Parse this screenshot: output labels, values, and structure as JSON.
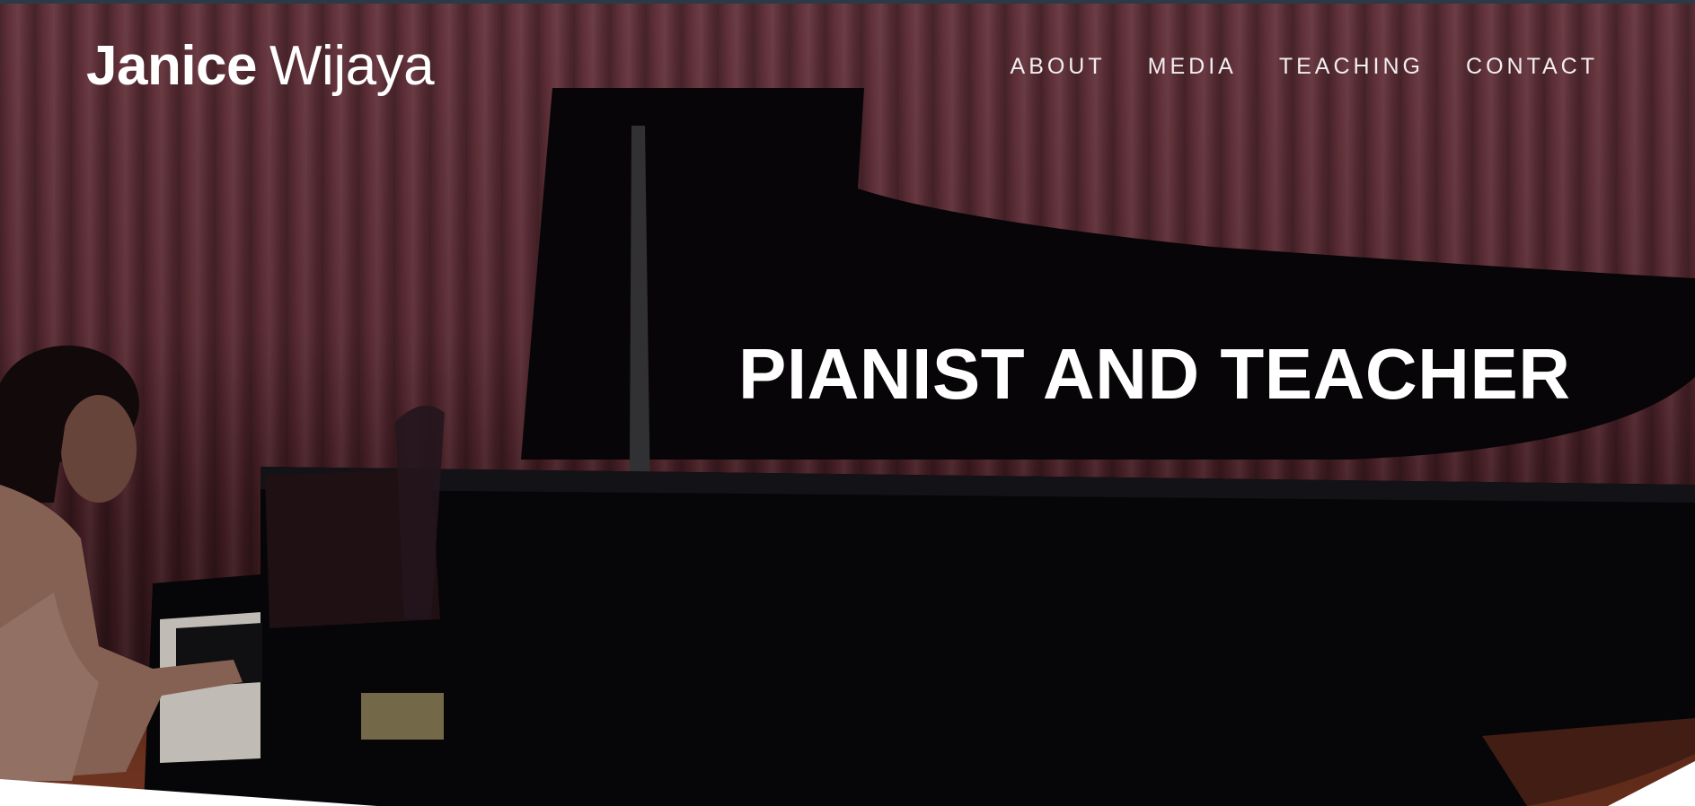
{
  "site": {
    "brand_first": "Janice",
    "brand_last": "Wijaya"
  },
  "nav": {
    "items": [
      {
        "label": "ABOUT"
      },
      {
        "label": "MEDIA"
      },
      {
        "label": "TEACHING"
      },
      {
        "label": "CONTACT"
      }
    ]
  },
  "hero": {
    "headline": "PIANIST AND TEACHER",
    "image_subject": "pianist-at-grand-piano-photo"
  },
  "colors": {
    "curtain": "#6d343f",
    "piano": "#0a0a0d",
    "text": "#ffffff",
    "topbar": "#2b3a44"
  }
}
